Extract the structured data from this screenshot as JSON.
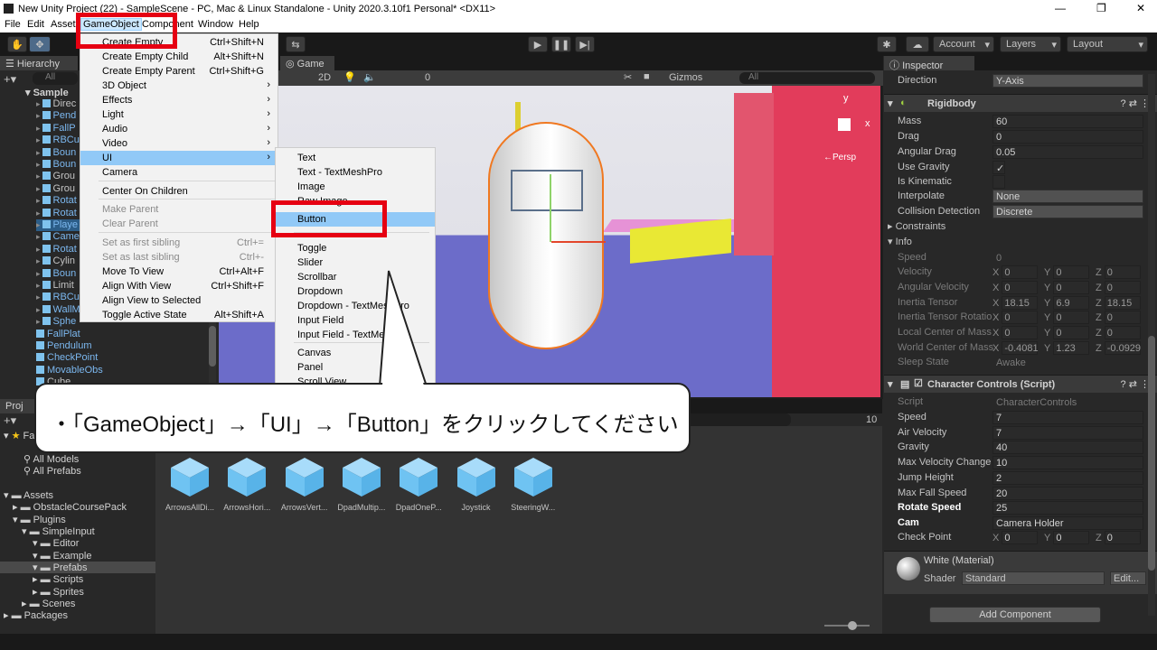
{
  "window": {
    "title": "New Unity Project (22) - SampleScene - PC, Mac & Linux Standalone - Unity 2020.3.10f1 Personal* <DX11>",
    "minimize": "—",
    "maximize": "❐",
    "close": "✕"
  },
  "menubar": [
    "File",
    "Edit",
    "Assets",
    "GameObject",
    "Component",
    "Window",
    "Help"
  ],
  "toolbar": {
    "account": "Account",
    "layers": "Layers",
    "layout": "Layout"
  },
  "hierarchy": {
    "tab": "Hierarchy",
    "search_placeholder": "All",
    "scene": "Sample",
    "items": [
      "Direc",
      "Pend",
      "FallP",
      "RBCu",
      "Boun",
      "Boun",
      "Grou",
      "Grou",
      "Rotat",
      "Rotat",
      "Playe",
      "Came",
      "Rotat",
      "Cylin",
      "Boun",
      "Limit",
      "RBCu",
      "WallM",
      "Sphe",
      "FallPlat",
      "Pendulum",
      "CheckPoint",
      "MovableObs",
      "Cube"
    ]
  },
  "game": {
    "tab": "Game",
    "controls": [
      "2D",
      "Gizmos",
      "All"
    ],
    "overlay_count": "0",
    "persp": "←Persp",
    "axis_y": "y",
    "axis_x": "x"
  },
  "gameobject_menu": {
    "items": [
      {
        "label": "Create Empty",
        "shortcut": "Ctrl+Shift+N"
      },
      {
        "label": "Create Empty Child",
        "shortcut": "Alt+Shift+N"
      },
      {
        "label": "Create Empty Parent",
        "shortcut": "Ctrl+Shift+G"
      },
      {
        "label": "3D Object",
        "shortcut": ""
      },
      {
        "label": "Effects",
        "shortcut": ""
      },
      {
        "label": "Light",
        "shortcut": ""
      },
      {
        "label": "Audio",
        "shortcut": ""
      },
      {
        "label": "Video",
        "shortcut": ""
      },
      {
        "label": "UI",
        "shortcut": ""
      },
      {
        "label": "Camera",
        "shortcut": ""
      },
      {
        "label": "Center On Children",
        "shortcut": ""
      },
      {
        "label": "Make Parent",
        "shortcut": ""
      },
      {
        "label": "Clear Parent",
        "shortcut": ""
      },
      {
        "label": "Set as first sibling",
        "shortcut": "Ctrl+="
      },
      {
        "label": "Set as last sibling",
        "shortcut": "Ctrl+-"
      },
      {
        "label": "Move To View",
        "shortcut": "Ctrl+Alt+F"
      },
      {
        "label": "Align With View",
        "shortcut": "Ctrl+Shift+F"
      },
      {
        "label": "Align View to Selected",
        "shortcut": ""
      },
      {
        "label": "Toggle Active State",
        "shortcut": "Alt+Shift+A"
      }
    ]
  },
  "ui_submenu": {
    "items": [
      "Text",
      "Text - TextMeshPro",
      "Image",
      "Raw Image",
      "Button",
      "Toggle",
      "Slider",
      "Scrollbar",
      "Dropdown",
      "Dropdown - TextMeshPro",
      "Input Field",
      "Input Field - TextMeshPro",
      "Canvas",
      "Panel",
      "Scroll View"
    ]
  },
  "callout": {
    "text": "・「GameObject」→「UI」→「Button」をクリックしてください"
  },
  "project": {
    "tab": "Proj",
    "favorites": "Fa",
    "fav_items": [
      "All Models",
      "All Prefabs"
    ],
    "tree": [
      "Assets",
      "ObstacleCoursePack",
      "Plugins",
      "SimpleInput",
      "Editor",
      "Example",
      "Prefabs",
      "Scripts",
      "Sprites",
      "Scenes",
      "Packages"
    ],
    "assets": [
      "ArrowsAllDi...",
      "ArrowsHori...",
      "ArrowsVert...",
      "DpadMultip...",
      "DpadOneP...",
      "Joystick",
      "SteeringW..."
    ],
    "count": "10"
  },
  "inspector": {
    "tab": "Inspector",
    "direction_label": "Direction",
    "direction_value": "Y-Axis",
    "rigidbody": {
      "title": "Rigidbody",
      "mass": {
        "label": "Mass",
        "value": "60"
      },
      "drag": {
        "label": "Drag",
        "value": "0"
      },
      "angular_drag": {
        "label": "Angular Drag",
        "value": "0.05"
      },
      "use_gravity": {
        "label": "Use Gravity",
        "value": "✓"
      },
      "is_kinematic": {
        "label": "Is Kinematic",
        "value": ""
      },
      "interpolate": {
        "label": "Interpolate",
        "value": "None"
      },
      "collision": {
        "label": "Collision Detection",
        "value": "Discrete"
      },
      "constraints": "Constraints",
      "info": "Info",
      "speed": {
        "label": "Speed",
        "value": "0"
      },
      "velocity": {
        "label": "Velocity",
        "x": "0",
        "y": "0",
        "z": "0"
      },
      "angular_velocity": {
        "label": "Angular Velocity",
        "x": "0",
        "y": "0",
        "z": "0"
      },
      "inertia_tensor": {
        "label": "Inertia Tensor",
        "x": "18.15",
        "y": "6.9",
        "z": "18.15"
      },
      "inertia_rotation": {
        "label": "Inertia Tensor Rotatio",
        "x": "0",
        "y": "0",
        "z": "0"
      },
      "local_com": {
        "label": "Local Center of Mass",
        "x": "0",
        "y": "0",
        "z": "0"
      },
      "world_com": {
        "label": "World Center of Mass",
        "x": "-0.4081",
        "y": "1.23",
        "z": "-0.0929"
      },
      "sleep_state": {
        "label": "Sleep State",
        "value": "Awake"
      }
    },
    "character_controls": {
      "title": "Character Controls (Script)",
      "script": {
        "label": "Script",
        "value": "CharacterControls"
      },
      "speed": {
        "label": "Speed",
        "value": "7"
      },
      "air_velocity": {
        "label": "Air Velocity",
        "value": "7"
      },
      "gravity": {
        "label": "Gravity",
        "value": "40"
      },
      "max_velocity_change": {
        "label": "Max Velocity Change",
        "value": "10"
      },
      "jump_height": {
        "label": "Jump Height",
        "value": "2"
      },
      "max_fall_speed": {
        "label": "Max Fall Speed",
        "value": "20"
      },
      "rotate_speed": {
        "label": "Rotate Speed",
        "value": "25"
      },
      "cam": {
        "label": "Cam",
        "value": "Camera Holder"
      },
      "check_point": {
        "label": "Check Point",
        "x": "0",
        "y": "0",
        "z": "0"
      }
    },
    "material": {
      "title": "White (Material)",
      "shader_label": "Shader",
      "shader_value": "Standard",
      "edit": "Edit..."
    },
    "add_component": "Add Component"
  },
  "axis_labels": {
    "x": "X",
    "y": "Y",
    "z": "Z"
  },
  "colors": {
    "accent_red": "#e60012",
    "menu_highlight": "#91c9f7",
    "prefab_blue": "#7cb8f0"
  }
}
